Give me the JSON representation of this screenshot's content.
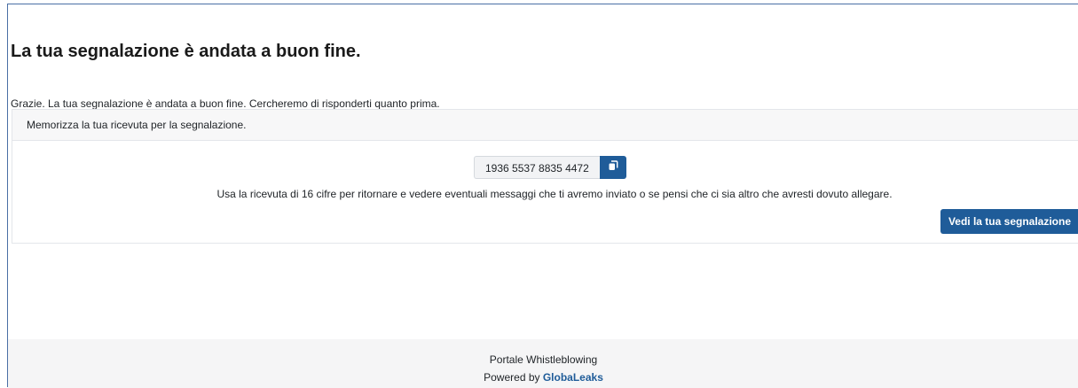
{
  "page": {
    "title": "La tua segnalazione è andata a buon fine.",
    "thanks_message": "Grazie. La tua segnalazione è andata a buon fine. Cercheremo di risponderti quanto prima."
  },
  "receipt_card": {
    "header": "Memorizza la tua ricevuta per la segnalazione.",
    "receipt_code": "1936 5537 8835 4472",
    "copy_icon": "copy-icon",
    "instructions": "Usa la ricevuta di 16 cifre per ritornare e vedere eventuali messaggi che ti avremo inviato o se pensi che ci sia altro che avresti dovuto allegare.",
    "view_button_label": "Vedi la tua segnalazione"
  },
  "footer": {
    "portal_name": "Portale Whistleblowing",
    "powered_by": "Powered by",
    "brand": "GlobaLeaks"
  },
  "colors": {
    "accent": "#1f5c99",
    "footer_bg": "#f5f5f6",
    "card_header_bg": "#f7f7f8"
  }
}
